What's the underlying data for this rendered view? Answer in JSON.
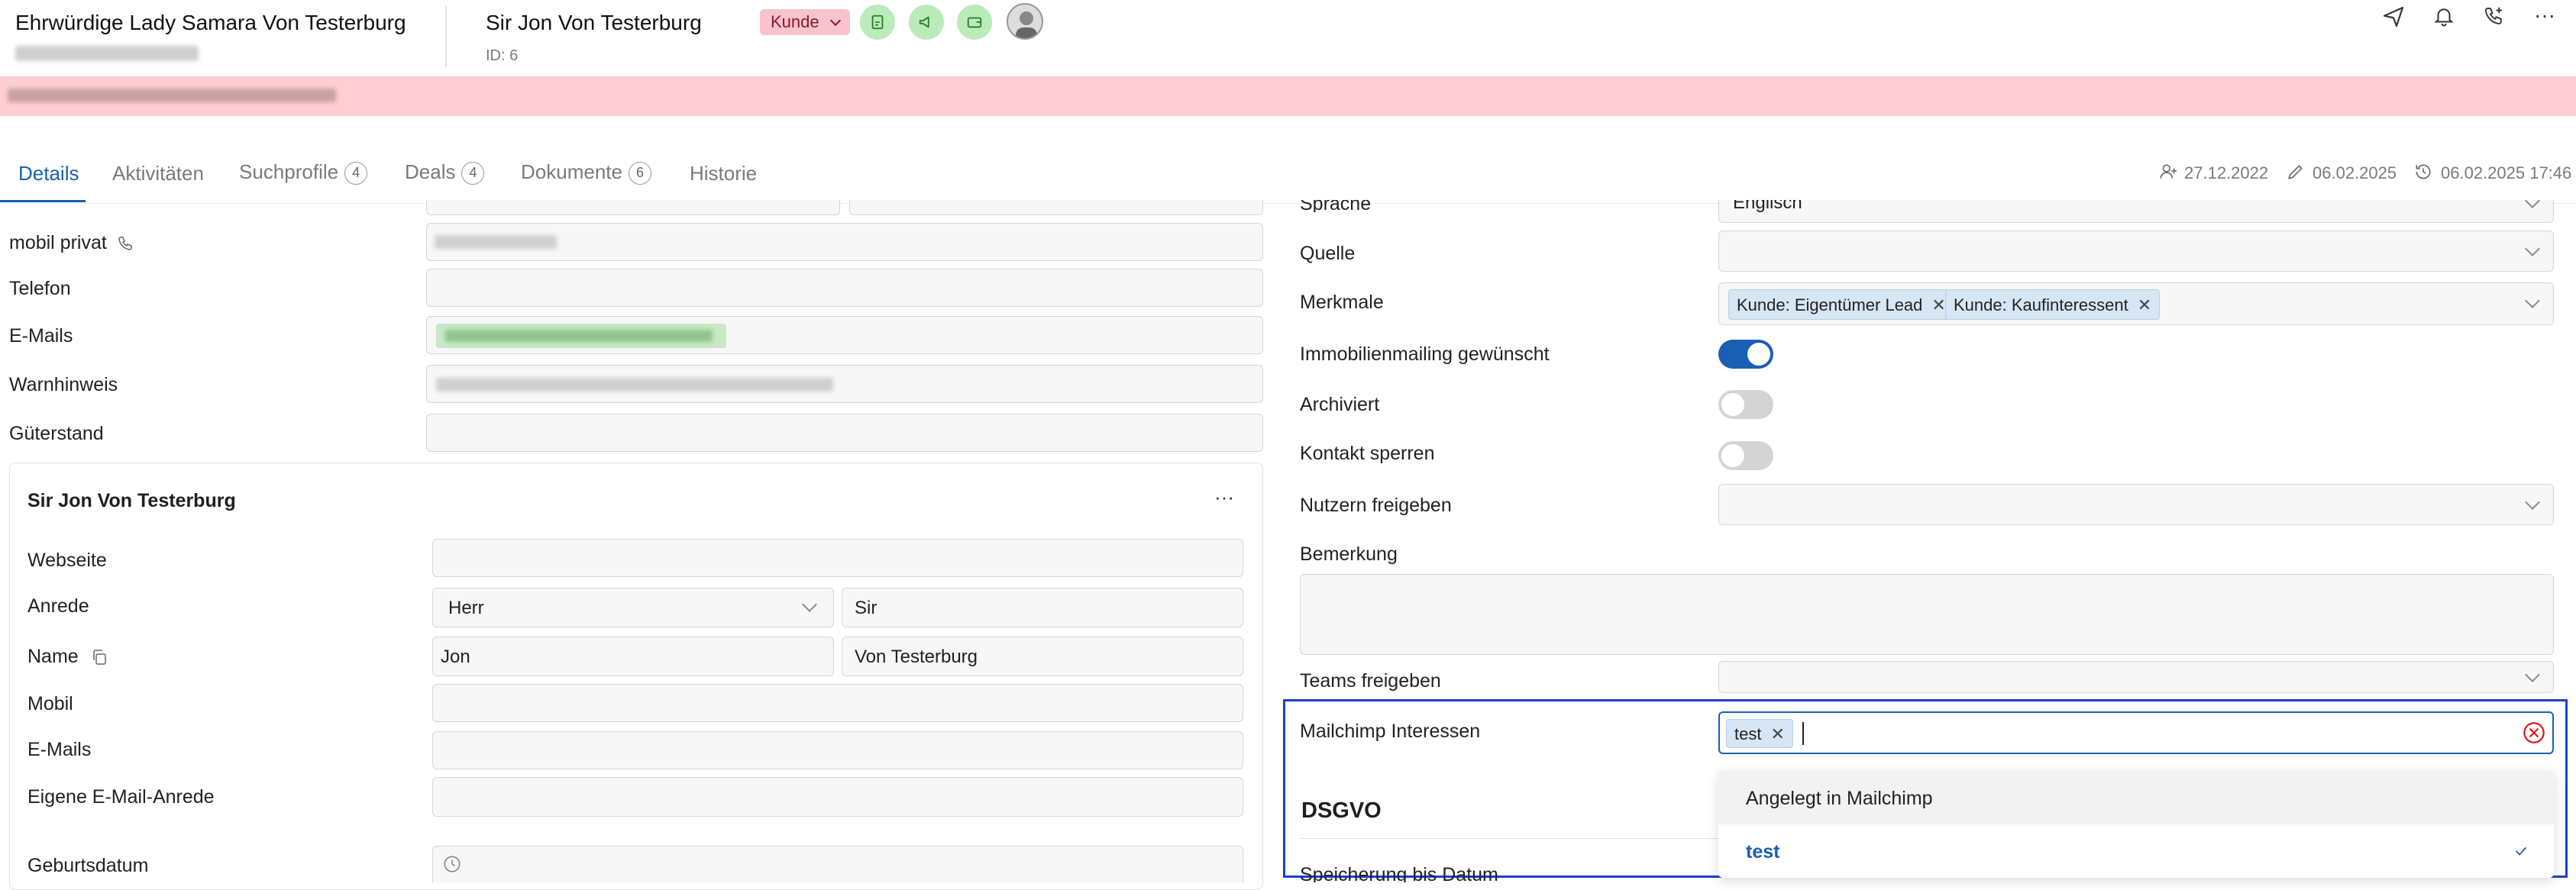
{
  "header": {
    "contact_name": "Ehrwürdige Lady Samara Von Testerburg",
    "person_name": "Sir Jon Von Testerburg",
    "id_label": "ID: 6",
    "status_tag": "Kunde",
    "banner_text": ""
  },
  "tabs": [
    {
      "label": "Details"
    },
    {
      "label": "Aktivitäten"
    },
    {
      "label": "Suchprofile",
      "count": "4"
    },
    {
      "label": "Deals",
      "count": "4"
    },
    {
      "label": "Dokumente",
      "count": "6"
    },
    {
      "label": "Historie"
    }
  ],
  "meta": {
    "created": "27.12.2022",
    "edited": "06.02.2025",
    "history": "06.02.2025 17:46"
  },
  "left": {
    "mobil_privat": "mobil privat",
    "telefon": "Telefon",
    "emails": "E-Mails",
    "warnhinweis": "Warnhinweis",
    "gueterstand": "Güterstand"
  },
  "card": {
    "title": "Sir Jon Von Testerburg",
    "more": "···",
    "webseite": "Webseite",
    "anrede": "Anrede",
    "anrede_value": "Herr",
    "titel_value": "Sir",
    "name": "Name",
    "first_name": "Jon",
    "last_name": "Von Testerburg",
    "mobil": "Mobil",
    "emails": "E-Mails",
    "eigene_anrede": "Eigene E-Mail-Anrede",
    "geburtsdatum": "Geburtsdatum"
  },
  "right": {
    "sprache": "Sprache",
    "sprache_value": "Englisch",
    "quelle": "Quelle",
    "merkmale": "Merkmale",
    "merkmale_chips": [
      "Kunde: Eigentümer Lead",
      "Kunde: Kaufinteressent"
    ],
    "immomailing": "Immobilienmailing gewünscht",
    "immomailing_on": true,
    "archiviert": "Archiviert",
    "kontakt_sperren": "Kontakt sperren",
    "nutzern_freigeben": "Nutzern freigeben",
    "bemerkung": "Bemerkung",
    "teams_freigeben": "Teams freigeben",
    "mailchimp": "Mailchimp Interessen",
    "mailchimp_chip": "test",
    "dsgvo": "DSGVO",
    "speicherung": "Speicherung bis Datum"
  },
  "dropdown": {
    "options": [
      "Angelegt in Mailchimp",
      "test"
    ],
    "selected": "test"
  },
  "colors": {
    "accent": "#1a5fb4",
    "banner": "#ffcdd2",
    "tag": "#f8c3cc",
    "toggle_on": "#1a5fb4",
    "green": "#b9ecb9",
    "highlight": "#1d3fd1"
  }
}
